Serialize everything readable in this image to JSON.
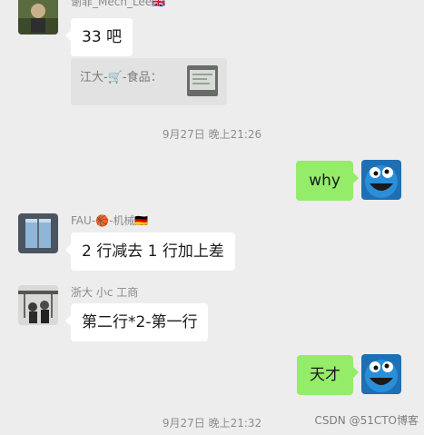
{
  "messages": [
    {
      "sender": "谢菲_Mech_Lee🇬🇧",
      "text": "33 吧"
    },
    {
      "quote": "江大-🛒-食品："
    },
    {
      "timestamp": "9月27日 晚上21:26"
    },
    {
      "self_text": "why"
    },
    {
      "sender": "FAU-🏀-机械🇩🇪",
      "text": "2 行减去 1 行加上差"
    },
    {
      "sender": "浙大 小c 工商",
      "text": "第二行*2-第一行"
    },
    {
      "self_text": "天才"
    },
    {
      "timestamp": "9月27日 晚上21:32"
    }
  ],
  "watermark": "CSDN @51CTO博客",
  "colors": {
    "background": "#ededed",
    "self_bubble": "#95ec69",
    "other_bubble": "#ffffff"
  },
  "icons": {
    "avatar_1": "person-outdoor-avatar",
    "avatar_self": "cookie-monster-avatar",
    "avatar_2": "window-sky-avatar",
    "avatar_3": "people-group-avatar"
  }
}
